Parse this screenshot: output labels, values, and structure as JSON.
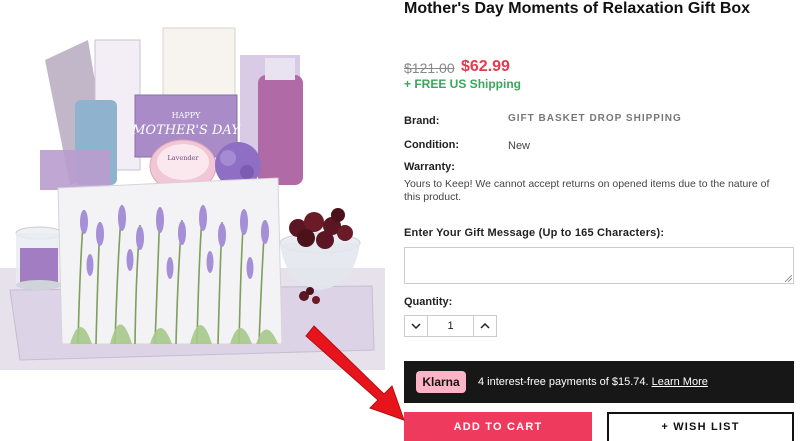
{
  "product": {
    "title": "Mother's Day Moments of Relaxation Gift Box",
    "price_original": "$121.00",
    "price_sale": "$62.99",
    "shipping": "+ FREE US Shipping",
    "image_label": "HAPPY MOTHER'S DAY",
    "image_sub": "Lavender"
  },
  "specs": {
    "brand_label": "Brand:",
    "brand_value": "GIFT BASKET DROP SHIPPING",
    "condition_label": "Condition:",
    "condition_value": "New",
    "warranty_label": "Warranty:",
    "warranty_text": "Yours to Keep! We cannot accept returns on opened items due to the nature of this product."
  },
  "gift_message": {
    "label": "Enter Your Gift Message (Up to 165 Characters):",
    "value": ""
  },
  "quantity": {
    "label": "Quantity:",
    "value": "1"
  },
  "klarna": {
    "badge": "Klarna",
    "text": "4 interest-free payments of $15.74.",
    "link": "Learn More"
  },
  "actions": {
    "add_to_cart": "ADD TO CART",
    "wish_list": "+ WISH LIST"
  },
  "colors": {
    "sale_price": "#e8394f",
    "shipping": "#3aa75a",
    "add_to_cart": "#ee3a5c",
    "klarna_bar": "#171717",
    "klarna_badge": "#ffb3c7",
    "annotation_arrow": "#e8141c"
  },
  "annotation": {
    "icon": "red-arrow-icon",
    "points_to": "add-to-cart-button"
  }
}
